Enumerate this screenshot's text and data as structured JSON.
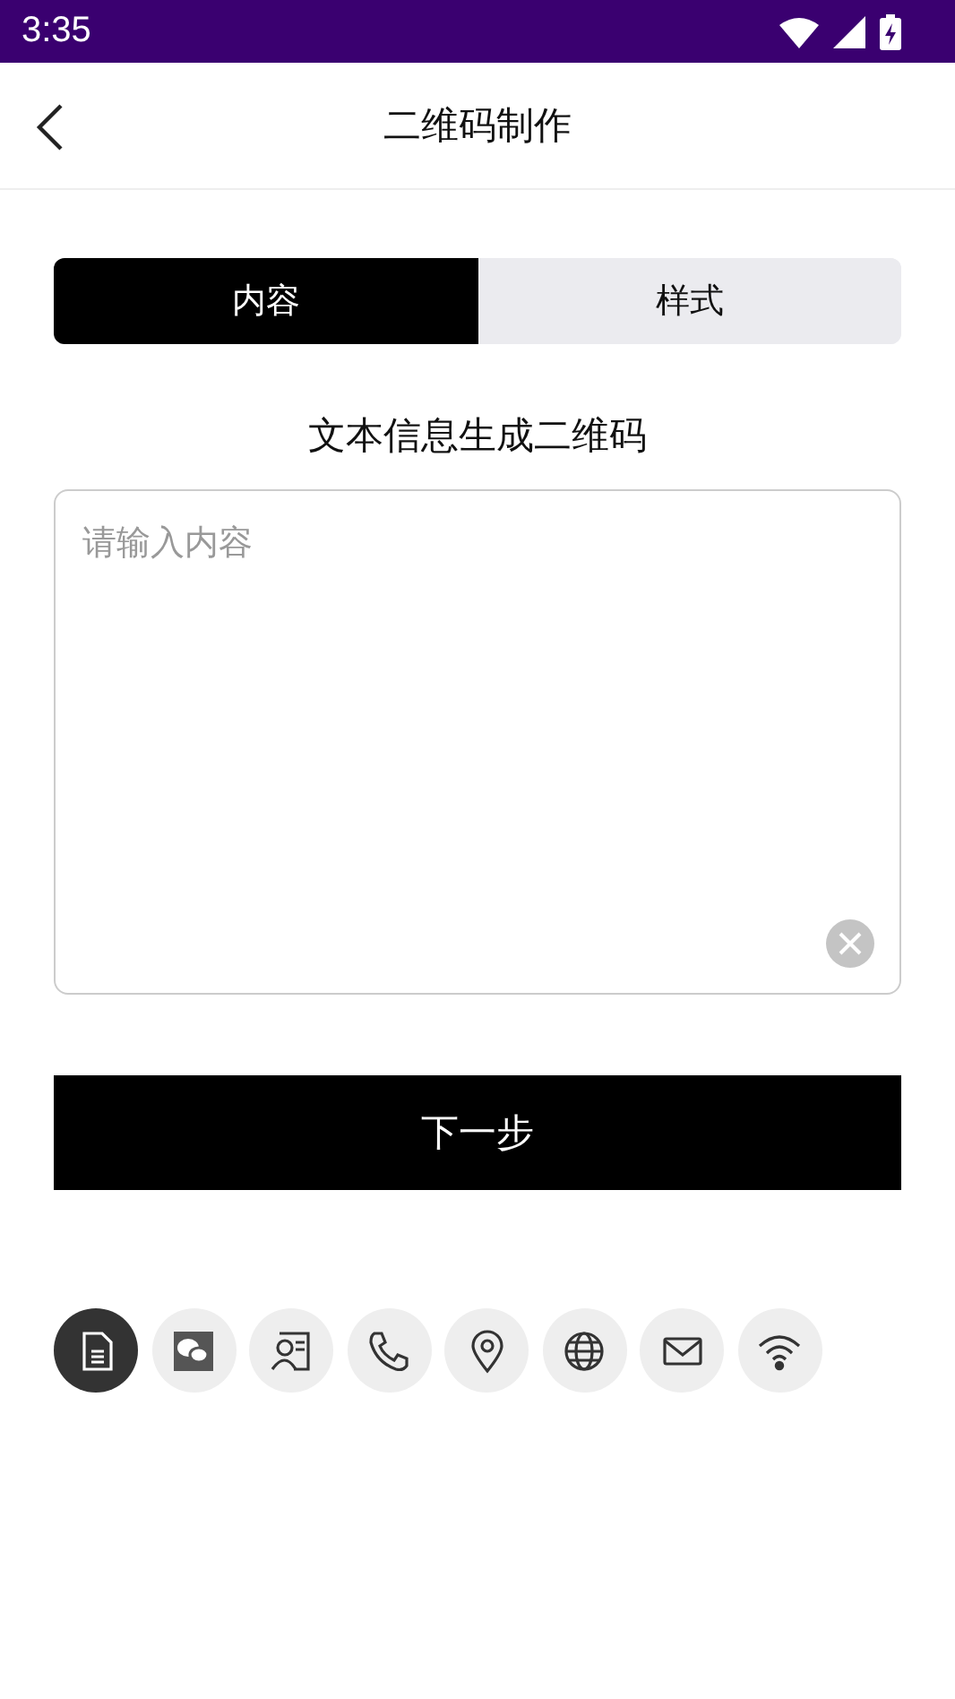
{
  "status_bar": {
    "time": "3:35"
  },
  "header": {
    "title": "二维码制作"
  },
  "tabs": [
    {
      "label": "内容",
      "selected": true
    },
    {
      "label": "样式",
      "selected": false
    }
  ],
  "heading": "文本信息生成二维码",
  "content_field": {
    "placeholder": "请输入内容"
  },
  "next_button": "下一步",
  "types": [
    {
      "kind": "text",
      "selected": true
    },
    {
      "kind": "wechat",
      "selected": false
    },
    {
      "kind": "card",
      "selected": false
    },
    {
      "kind": "phone",
      "selected": false
    },
    {
      "kind": "location",
      "selected": false
    },
    {
      "kind": "web",
      "selected": false
    },
    {
      "kind": "email",
      "selected": false
    },
    {
      "kind": "wifi",
      "selected": false
    }
  ]
}
